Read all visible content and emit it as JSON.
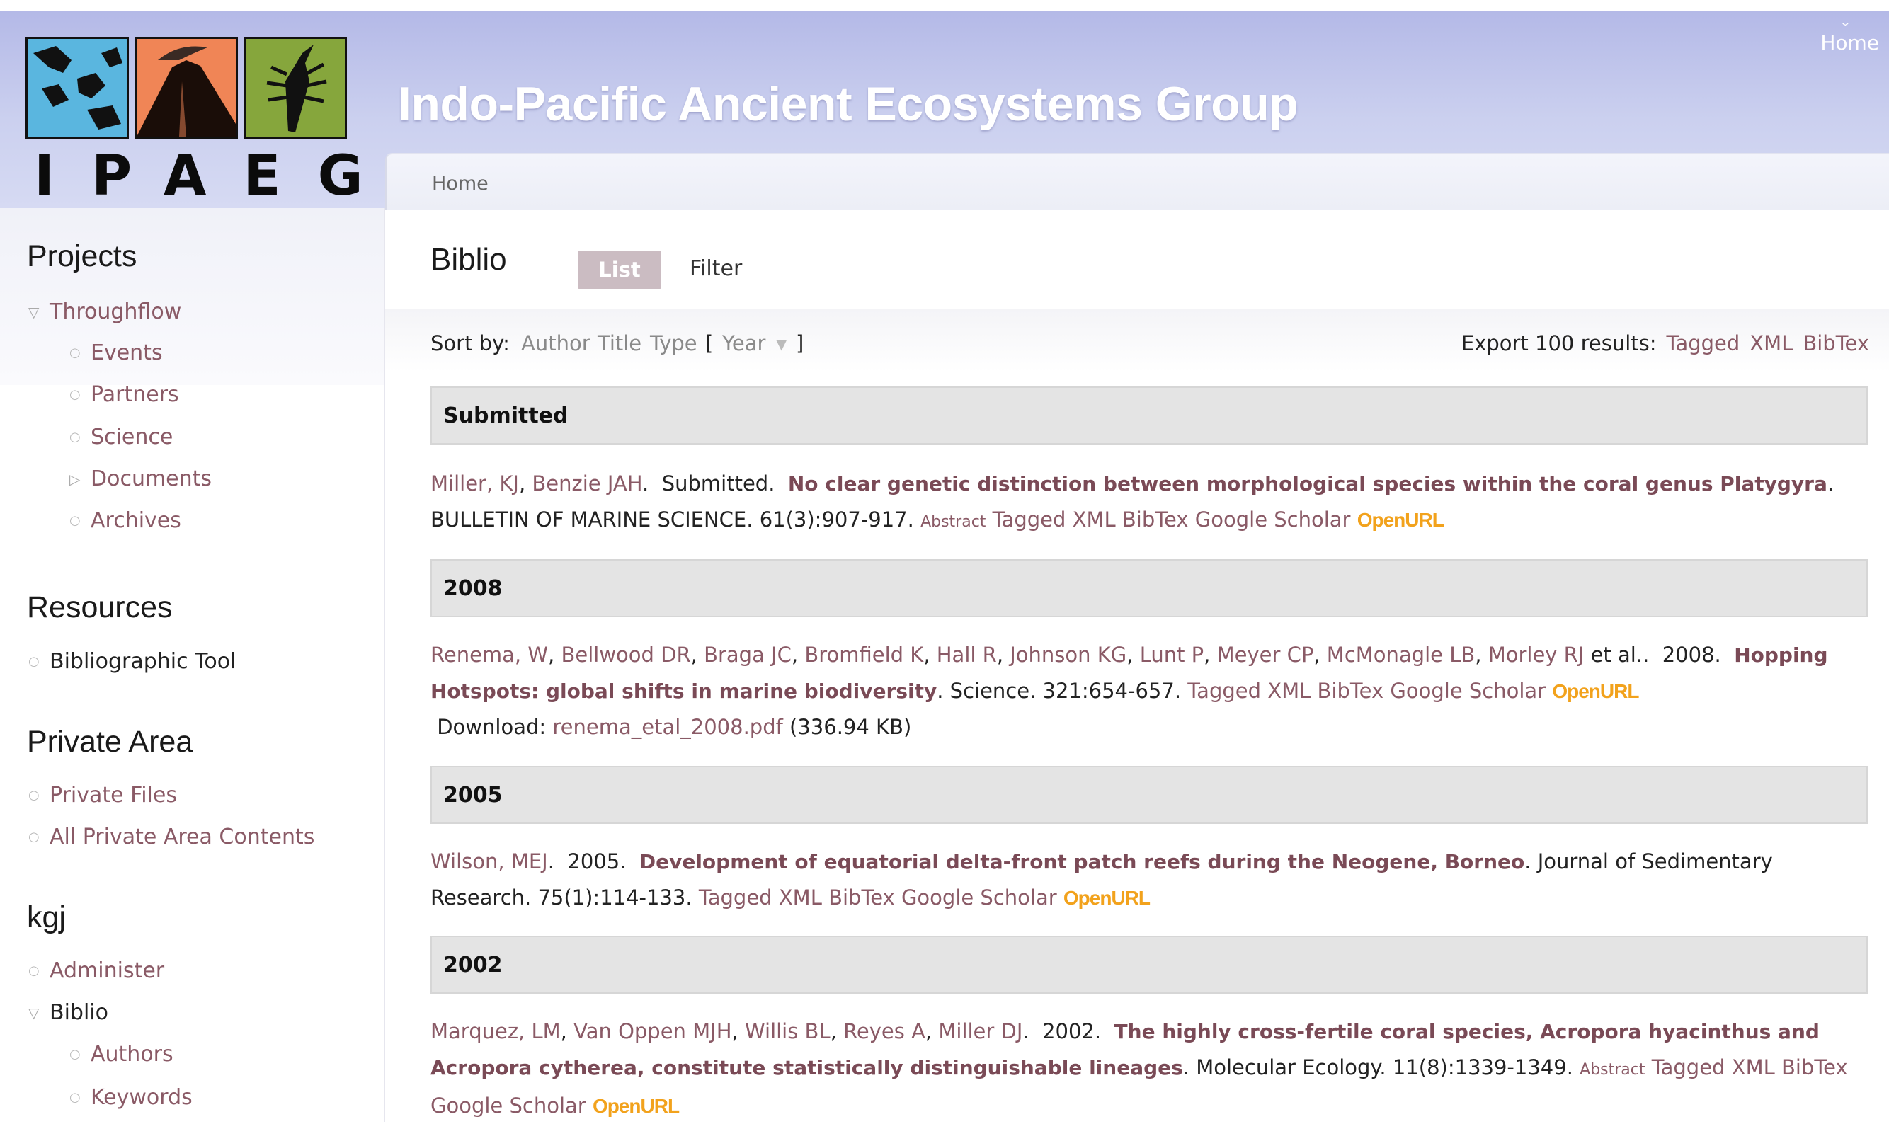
{
  "header": {
    "logo_letters": "IPAEG",
    "site_title": "Indo-Pacific Ancient Ecosystems Group",
    "home_link": "Home",
    "breadcrumb": "Home"
  },
  "sidebar": {
    "projects": {
      "title": "Projects",
      "items": [
        {
          "label": "Throughflow"
        },
        {
          "label": "Events"
        },
        {
          "label": "Partners"
        },
        {
          "label": "Science"
        },
        {
          "label": "Documents"
        },
        {
          "label": "Archives"
        }
      ]
    },
    "resources": {
      "title": "Resources",
      "items": [
        {
          "label": "Bibliographic Tool"
        }
      ]
    },
    "private": {
      "title": "Private Area",
      "items": [
        {
          "label": "Private Files"
        },
        {
          "label": "All Private Area Contents"
        }
      ]
    },
    "user": {
      "title": "kgj",
      "items": [
        {
          "label": "Administer"
        },
        {
          "label": "Biblio"
        },
        {
          "label": "Authors"
        },
        {
          "label": "Keywords"
        }
      ]
    }
  },
  "main": {
    "page_title": "Biblio",
    "tabs": {
      "list": "List",
      "filter": "Filter"
    },
    "sort": {
      "label": "Sort by:",
      "author": "Author",
      "title": "Title",
      "type": "Type",
      "open_bracket": "[",
      "year": "Year",
      "close_bracket": "]"
    },
    "export": {
      "label": "Export 100 results:",
      "tagged": "Tagged",
      "xml": "XML",
      "bibtex": "BibTex"
    },
    "sections": {
      "submitted": "Submitted",
      "y2008": "2008",
      "y2005": "2005",
      "y2002": "2002"
    },
    "entries": {
      "e1": {
        "authors": [
          "Miller, KJ",
          "Benzie JAH"
        ],
        "year": "Submitted",
        "title": "No clear genetic distinction between morphological species within the coral genus Platygyra",
        "journal": "BULLETIN OF MARINE SCIENCE. 61(3):907-917.",
        "abstract": "Abstract"
      },
      "e2": {
        "authors": [
          "Renema, W",
          "Bellwood DR",
          "Braga JC",
          "Bromfield K",
          "Hall R",
          "Johnson KG",
          "Lunt P",
          "Meyer CP",
          "McMonagle LB",
          "Morley RJ"
        ],
        "etal": "et al..",
        "year": "2008",
        "title": "Hopping Hotspots: global shifts in marine biodiversity",
        "journal": "Science. 321:654-657.",
        "download_label": "Download:",
        "download_file": "renema_etal_2008.pdf",
        "download_size": "(336.94 KB)"
      },
      "e3": {
        "authors": [
          "Wilson, MEJ"
        ],
        "year": "2005",
        "title": "Development of equatorial delta-front patch reefs during the Neogene, Borneo",
        "journal": "Journal of Sedimentary Research. 75(1):114-133."
      },
      "e4": {
        "authors": [
          "Marquez, LM",
          "Van Oppen MJH",
          "Willis BL",
          "Reyes A",
          "Miller DJ"
        ],
        "year": "2002",
        "title": "The highly cross-fertile coral species, Acropora hyacinthus and Acropora cytherea, constitute statistically distinguishable lineages",
        "journal": "Molecular Ecology. 11(8):1339-1349.",
        "abstract": "Abstract"
      }
    },
    "links": {
      "tagged": "Tagged",
      "xml": "XML",
      "bibtex": "BibTex",
      "google_scholar": "Google Scholar",
      "openurl": "OpenURL"
    }
  },
  "colors": {
    "header_bg": "#c4c9ee",
    "link": "#8a5a66",
    "openurl": "#f2a21c",
    "section_bg": "#e4e4e4",
    "tab_active": "#cbbcc2"
  }
}
